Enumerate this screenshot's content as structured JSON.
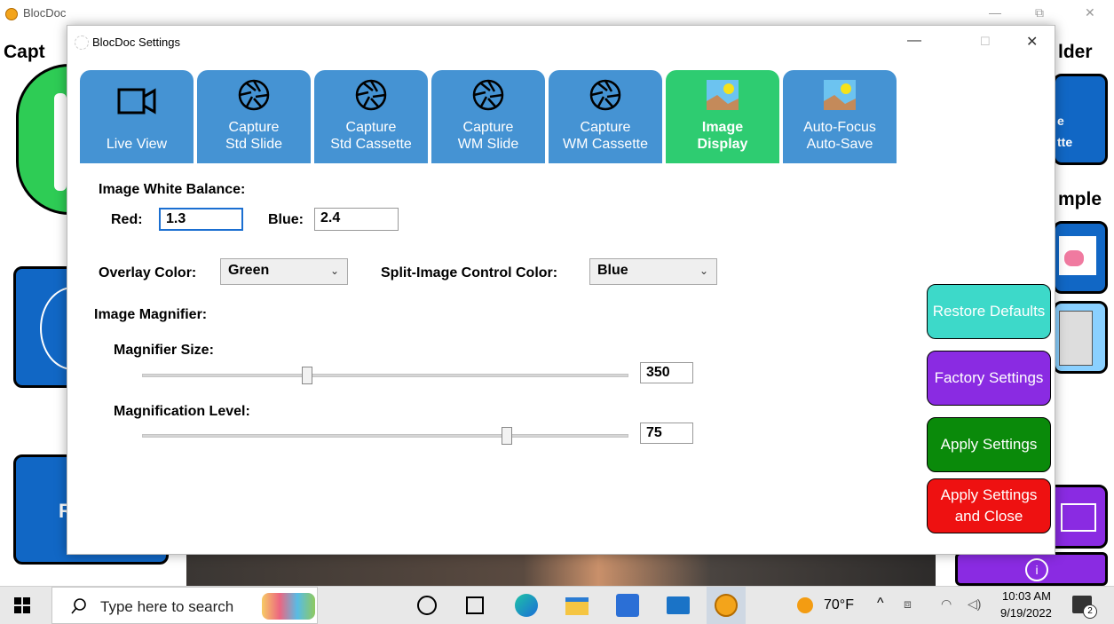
{
  "app": {
    "title": "BlocDoc",
    "heading_left": "Capt",
    "heading_right_top": "lder",
    "heading_right_mid": "mple",
    "side_fragment_1": "e",
    "side_fragment_2": "tte",
    "side_fragment_3": "R"
  },
  "dialog": {
    "title": "BlocDoc Settings",
    "controls": {
      "minimize": "—",
      "maximize": "☐",
      "close": "✕"
    },
    "tabs": [
      {
        "label_line1": "",
        "label_line2": "Live View",
        "icon": "video-camera-icon",
        "active": false
      },
      {
        "label_line1": "Capture",
        "label_line2": "Std Slide",
        "icon": "shutter-icon",
        "active": false
      },
      {
        "label_line1": "Capture",
        "label_line2": "Std Cassette",
        "icon": "shutter-icon",
        "active": false
      },
      {
        "label_line1": "Capture",
        "label_line2": "WM Slide",
        "icon": "shutter-icon",
        "active": false
      },
      {
        "label_line1": "Capture",
        "label_line2": "WM Cassette",
        "icon": "shutter-icon",
        "active": false
      },
      {
        "label_line1": "Image",
        "label_line2": "Display",
        "icon": "image-icon",
        "active": true
      },
      {
        "label_line1": "Auto-Focus",
        "label_line2": "Auto-Save",
        "icon": "image-icon",
        "active": false
      }
    ],
    "white_balance": {
      "heading": "Image White Balance:",
      "red_label": "Red:",
      "red_value": "1.3",
      "blue_label": "Blue:",
      "blue_value": "2.4"
    },
    "overlay": {
      "label": "Overlay Color:",
      "value": "Green"
    },
    "split_image": {
      "label": "Split-Image Control Color:",
      "value": "Blue"
    },
    "magnifier": {
      "heading": "Image Magnifier:",
      "size_label": "Magnifier Size:",
      "size_value": "350",
      "size_fraction": 0.34,
      "level_label": "Magnification Level:",
      "level_value": "75",
      "level_fraction": 0.75
    },
    "buttons": {
      "restore": "Restore Defaults",
      "factory": "Factory Settings",
      "apply": "Apply Settings",
      "apply_close": "Apply Settings and Close"
    },
    "colors": {
      "tab_blue": "#4593d3",
      "tab_active": "#2ecc71",
      "restore": "#3dd9c9",
      "factory": "#8a2be2",
      "apply": "#0a8a0a",
      "apply_close": "#ee1111"
    }
  },
  "taskbar": {
    "search_placeholder": "Type here to search",
    "weather": "70°F",
    "time": "10:03 AM",
    "date": "9/19/2022",
    "notification_count": "2"
  }
}
